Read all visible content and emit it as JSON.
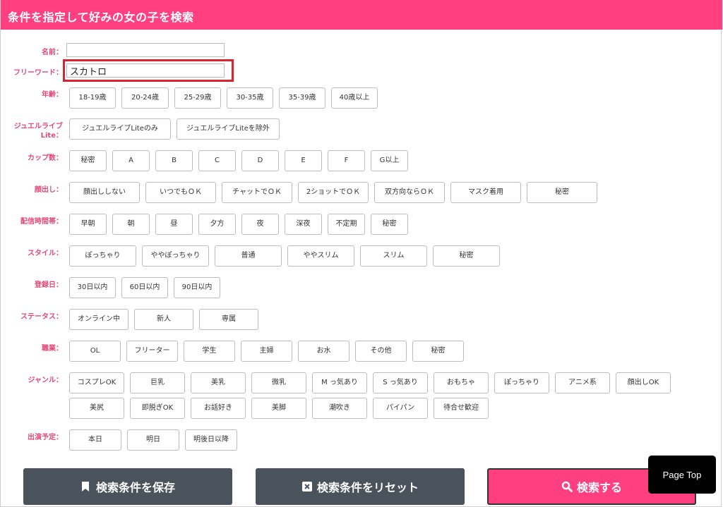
{
  "header": {
    "title": "条件を指定して好みの女の子を検索"
  },
  "name_field": {
    "label": "名前：",
    "value": ""
  },
  "freeword_field": {
    "label": "フリーワード：",
    "value": "スカトロ"
  },
  "rows": [
    {
      "id": "age",
      "label": "年齢：",
      "options": [
        "18-19歳",
        "20-24歳",
        "25-29歳",
        "30-35歳",
        "35-39歳",
        "40歳以上"
      ]
    },
    {
      "id": "jewel",
      "label": "ジュエルライブLite：",
      "options": [
        "ジュエルライブLiteのみ",
        "ジュエルライブLiteを除外"
      ]
    },
    {
      "id": "cup",
      "label": "カップ数：",
      "options": [
        "秘密",
        "A",
        "B",
        "C",
        "D",
        "E",
        "F",
        "G以上"
      ]
    },
    {
      "id": "face",
      "label": "顔出し：",
      "options": [
        "顔出ししない",
        "いつでもＯＫ",
        "チャットでＯＫ",
        "2ショットでＯＫ",
        "双方向ならＯＫ",
        "マスク着用",
        "秘密"
      ]
    },
    {
      "id": "time",
      "label": "配信時間帯：",
      "options": [
        "早朝",
        "朝",
        "昼",
        "夕方",
        "夜",
        "深夜",
        "不定期",
        "秘密"
      ]
    },
    {
      "id": "style",
      "label": "スタイル：",
      "options": [
        "ぽっちゃり",
        "ややぽっちゃり",
        "普通",
        "ややスリム",
        "スリム",
        "秘密"
      ]
    },
    {
      "id": "reg",
      "label": "登録日：",
      "options": [
        "30日以内",
        "60日以内",
        "90日以内"
      ]
    },
    {
      "id": "status",
      "label": "ステータス：",
      "options": [
        "オンライン中",
        "新人",
        "専属"
      ]
    },
    {
      "id": "job",
      "label": "職業：",
      "options": [
        "OL",
        "フリーター",
        "学生",
        "主婦",
        "お水",
        "その他",
        "秘密"
      ]
    },
    {
      "id": "genre",
      "label": "ジャンル：",
      "options": [
        "コスプレOK",
        "巨乳",
        "美乳",
        "微乳",
        "M っ気あり",
        "S っ気あり",
        "おもちゃ",
        "ぽっちゃり",
        "アニメ系",
        "顔出しOK",
        "美尻",
        "即脱ぎOK",
        "お話好き",
        "美脚",
        "潮吹き",
        "パイパン",
        "待合せ歓迎"
      ]
    },
    {
      "id": "plan",
      "label": "出演予定：",
      "options": [
        "本日",
        "明日",
        "明後日以降"
      ]
    }
  ],
  "actions": {
    "save": "検索条件を保存",
    "reset": "検索条件をリセット",
    "search": "検索する"
  },
  "page_top": "Page Top",
  "colors": {
    "accent": "#ff3f7f",
    "label": "#e04a78",
    "highlight": "#d9232e",
    "dark_button": "#4a525c"
  }
}
